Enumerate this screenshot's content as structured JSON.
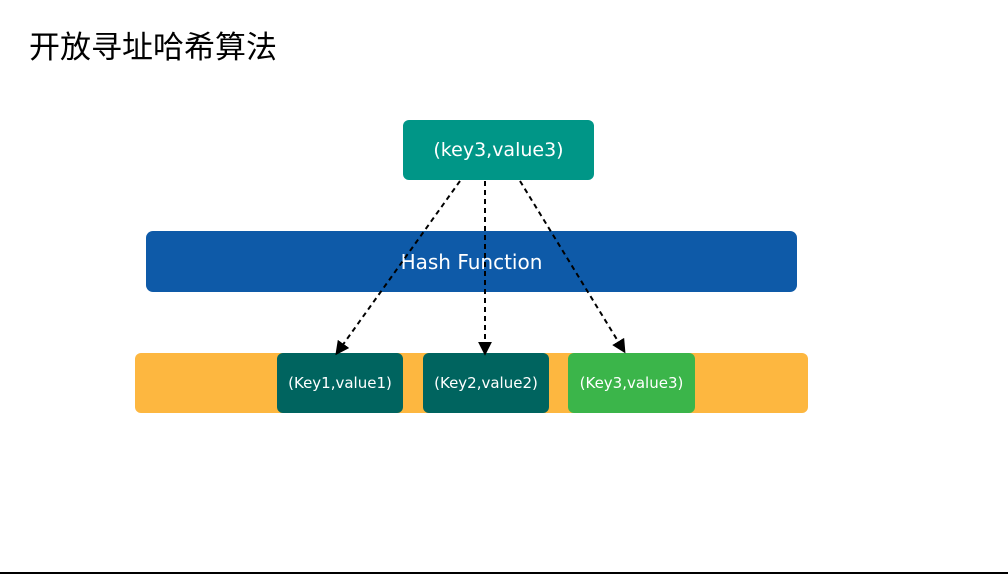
{
  "title": "开放寻址哈希算法",
  "input": {
    "label": "(key3,value3)"
  },
  "hash_function": {
    "label": "Hash Function"
  },
  "table": {
    "slots": [
      {
        "label": "(Key1,value1)"
      },
      {
        "label": "(Key2,value2)"
      },
      {
        "label": "(Key3,value3)"
      }
    ]
  },
  "colors": {
    "input_box": "#009687",
    "hash_bar": "#0e5aa8",
    "table_bar": "#fdb740",
    "occupied_slot": "#00645f",
    "inserted_slot": "#3bb54a",
    "arrow": "#000000"
  }
}
